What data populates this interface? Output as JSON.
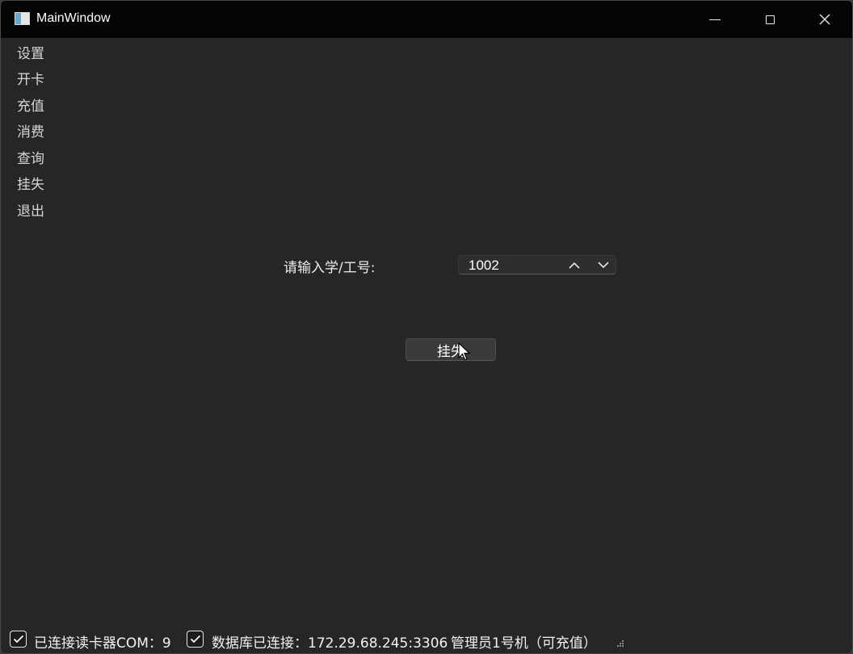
{
  "window": {
    "title": "MainWindow"
  },
  "menu": {
    "items": [
      "设置",
      "开卡",
      "充值",
      "消费",
      "查询",
      "挂失",
      "退出"
    ]
  },
  "form": {
    "id_label": "请输入学/工号:",
    "id_value": "1002",
    "submit_label": "挂失"
  },
  "statusbar": {
    "reader_status": "已连接读卡器COM：9",
    "reader_connected": true,
    "db_status": "数据库已连接：172.29.68.245:3306",
    "db_connected": true,
    "admin_info": "管理员1号机（可充值）"
  },
  "colors": {
    "window_bg": "#262626",
    "titlebar_bg": "#050505",
    "text": "#ececec"
  }
}
